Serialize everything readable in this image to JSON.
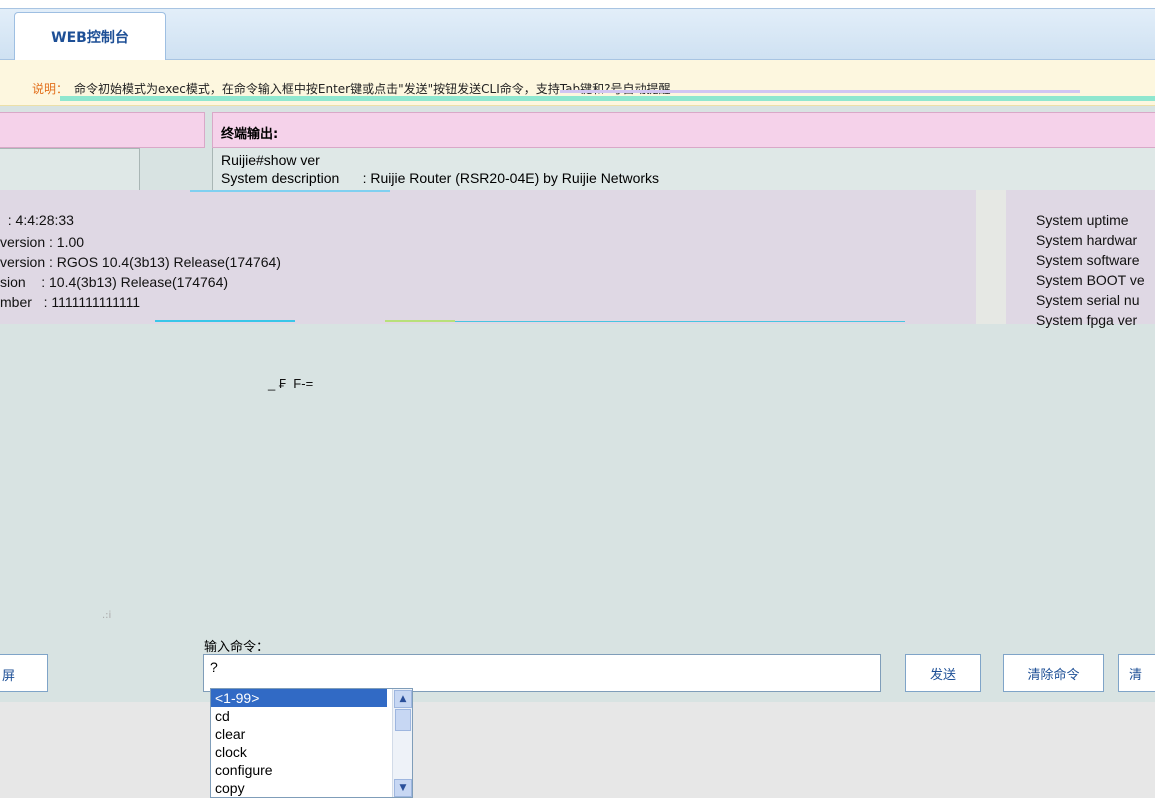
{
  "tab": {
    "label": "WEB控制台"
  },
  "notice": {
    "label": "说明：",
    "text": "命令初始模式为exec模式，在命令输入框中按Enter键或点击\"发送\"按钮发送CLI命令，支持Tab键和?号自动提醒"
  },
  "terminal": {
    "header": "终端输出:",
    "lines": [
      "Ruijie#show ver",
      "System description      : Ruijie Router (RSR20-04E) by Ruijie Networks"
    ],
    "ghost_left": [
      "  : 4:4:28:33",
      "version : 1.00",
      "version : RGOS 10.4(3b13) Release(174764)",
      "sion    : 10.4(3b13) Release(174764)",
      "mber   : 1111111111111"
    ],
    "ghost_right": [
      "System uptime",
      "System hardwar",
      "System software",
      "System BOOT ve",
      "System serial nu",
      "System fpga ver"
    ],
    "stray": "_ ₣  F-="
  },
  "input": {
    "label": "输入命令：",
    "value": "?",
    "left_button": "屏",
    "send": "发送",
    "clear_cmd": "清除命令",
    "clear_screen": "清"
  },
  "listbox": {
    "items": [
      "<1-99>",
      "cd",
      "clear",
      "clock",
      "configure",
      "copy"
    ],
    "selected": 0
  }
}
